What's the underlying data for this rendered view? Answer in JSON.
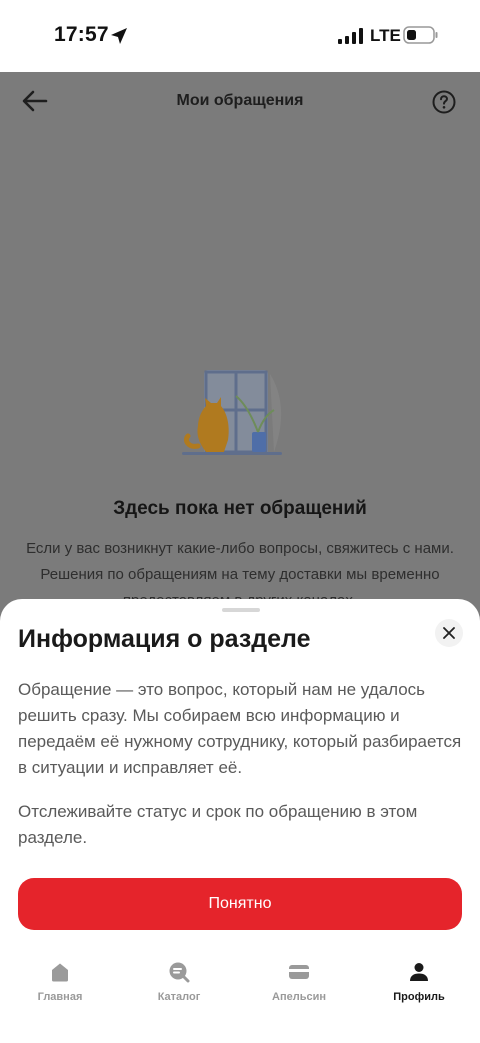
{
  "status_bar": {
    "time": "17:57",
    "network": "LTE"
  },
  "header": {
    "title": "Мои обращения"
  },
  "empty_state": {
    "title": "Здесь пока нет обращений",
    "text": "Если у вас возникнут какие-либо вопросы, свяжитесь с нами. Решения по обращениям на тему доставки мы временно предоставляем в других каналах."
  },
  "sheet": {
    "title": "Информация о разделе",
    "paragraph1": "Обращение — это вопрос, который нам не удалось решить сразу. Мы собираем всю информацию и передаём её нужному сотруднику, который разбирается в ситуации и исправляет её.",
    "paragraph2": "Отслеживайте статус и срок по обращению в этом разделе.",
    "button": "Понятно"
  },
  "tabs": [
    {
      "label": "Главная",
      "icon": "home-icon",
      "active": false
    },
    {
      "label": "Каталог",
      "icon": "catalog-search-icon",
      "active": false
    },
    {
      "label": "Апельсин",
      "icon": "card-icon",
      "active": false
    },
    {
      "label": "Профиль",
      "icon": "profile-icon",
      "active": true
    }
  ],
  "colors": {
    "accent": "#e5242b",
    "overlay": "#7b7b7b",
    "sheet": "#ffffff",
    "tab_inactive": "#9a9a9a",
    "tab_active": "#1a1a1a"
  }
}
